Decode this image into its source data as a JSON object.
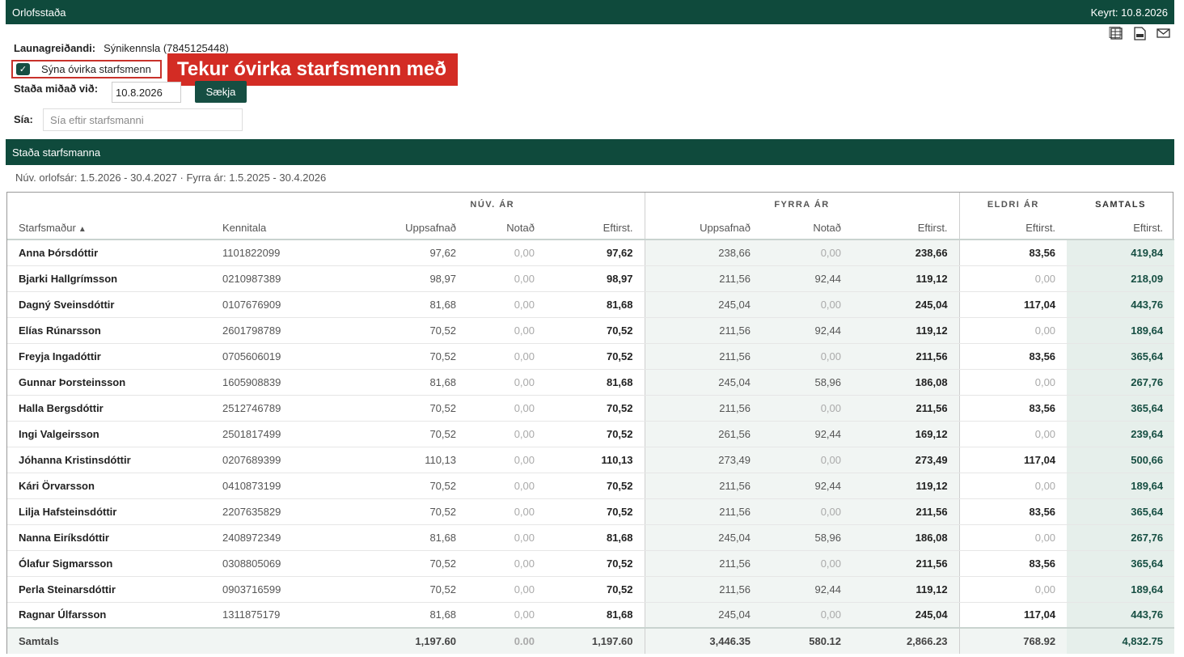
{
  "header": {
    "title": "Orlofsstaða",
    "run_label": "Keyrt: 10.8.2026"
  },
  "toolbar": {
    "icons": [
      "excel-icon",
      "pdf-icon",
      "email-icon"
    ]
  },
  "form": {
    "payer_label": "Launagreiðandi:",
    "payer_value": "Sýnikennsla (7845125448)",
    "inactive_checkbox_label": "Sýna óvirka starfsmenn",
    "inactive_checked": true,
    "callout": "Tekur óvirka starfsmenn með",
    "date_label": "Staða miðað við:",
    "date_value": "10.8.2026",
    "fetch_label": "Sækja",
    "filter_label": "Sía:",
    "filter_placeholder": "Sía eftir starfsmanni"
  },
  "section": {
    "title": "Staða starfsmanna",
    "period": "Núv. orlofsár: 1.5.2026 - 30.4.2027 · Fyrra ár: 1.5.2025 - 30.4.2026"
  },
  "table": {
    "groups": {
      "current": "NÚV. ÁR",
      "previous": "FYRRA ÁR",
      "older": "ELDRI ÁR",
      "total": "SAMTALS"
    },
    "columns": {
      "employee": "Starfsmaður",
      "sort_indicator": "▲",
      "kennitala": "Kennitala",
      "accrued": "Uppsafnað",
      "used": "Notað",
      "remaining": "Eftirst.",
      "prev_accrued": "Uppsafnað",
      "prev_used": "Notað",
      "prev_remaining": "Eftirst.",
      "older_remaining": "Eftirst.",
      "total_remaining": "Eftirst."
    },
    "rows": [
      [
        "Anna Þórsdóttir",
        "1101822099",
        "97,62",
        "0,00",
        "97,62",
        "238,66",
        "0,00",
        "238,66",
        "83,56",
        "419,84"
      ],
      [
        "Bjarki Hallgrímsson",
        "0210987389",
        "98,97",
        "0,00",
        "98,97",
        "211,56",
        "92,44",
        "119,12",
        "0,00",
        "218,09"
      ],
      [
        "Dagný Sveinsdóttir",
        "0107676909",
        "81,68",
        "0,00",
        "81,68",
        "245,04",
        "0,00",
        "245,04",
        "117,04",
        "443,76"
      ],
      [
        "Elías Rúnarsson",
        "2601798789",
        "70,52",
        "0,00",
        "70,52",
        "211,56",
        "92,44",
        "119,12",
        "0,00",
        "189,64"
      ],
      [
        "Freyja Ingadóttir",
        "0705606019",
        "70,52",
        "0,00",
        "70,52",
        "211,56",
        "0,00",
        "211,56",
        "83,56",
        "365,64"
      ],
      [
        "Gunnar Þorsteinsson",
        "1605908839",
        "81,68",
        "0,00",
        "81,68",
        "245,04",
        "58,96",
        "186,08",
        "0,00",
        "267,76"
      ],
      [
        "Halla Bergsdóttir",
        "2512746789",
        "70,52",
        "0,00",
        "70,52",
        "211,56",
        "0,00",
        "211,56",
        "83,56",
        "365,64"
      ],
      [
        "Ingi Valgeirsson",
        "2501817499",
        "70,52",
        "0,00",
        "70,52",
        "261,56",
        "92,44",
        "169,12",
        "0,00",
        "239,64"
      ],
      [
        "Jóhanna Kristinsdóttir",
        "0207689399",
        "110,13",
        "0,00",
        "110,13",
        "273,49",
        "0,00",
        "273,49",
        "117,04",
        "500,66"
      ],
      [
        "Kári Örvarsson",
        "0410873199",
        "70,52",
        "0,00",
        "70,52",
        "211,56",
        "92,44",
        "119,12",
        "0,00",
        "189,64"
      ],
      [
        "Lilja Hafsteinsdóttir",
        "2207635829",
        "70,52",
        "0,00",
        "70,52",
        "211,56",
        "0,00",
        "211,56",
        "83,56",
        "365,64"
      ],
      [
        "Nanna Eiríksdóttir",
        "2408972349",
        "81,68",
        "0,00",
        "81,68",
        "245,04",
        "58,96",
        "186,08",
        "0,00",
        "267,76"
      ],
      [
        "Ólafur Sigmarsson",
        "0308805069",
        "70,52",
        "0,00",
        "70,52",
        "211,56",
        "0,00",
        "211,56",
        "83,56",
        "365,64"
      ],
      [
        "Perla Steinarsdóttir",
        "0903716599",
        "70,52",
        "0,00",
        "70,52",
        "211,56",
        "92,44",
        "119,12",
        "0,00",
        "189,64"
      ],
      [
        "Ragnar Úlfarsson",
        "1311875179",
        "81,68",
        "0,00",
        "81,68",
        "245,04",
        "0,00",
        "245,04",
        "117,04",
        "443,76"
      ]
    ],
    "footer": [
      "Samtals",
      "",
      "1,197.60",
      "0.00",
      "1,197.60",
      "3,446.35",
      "580.12",
      "2,866.23",
      "768.92",
      "4,832.75"
    ]
  }
}
